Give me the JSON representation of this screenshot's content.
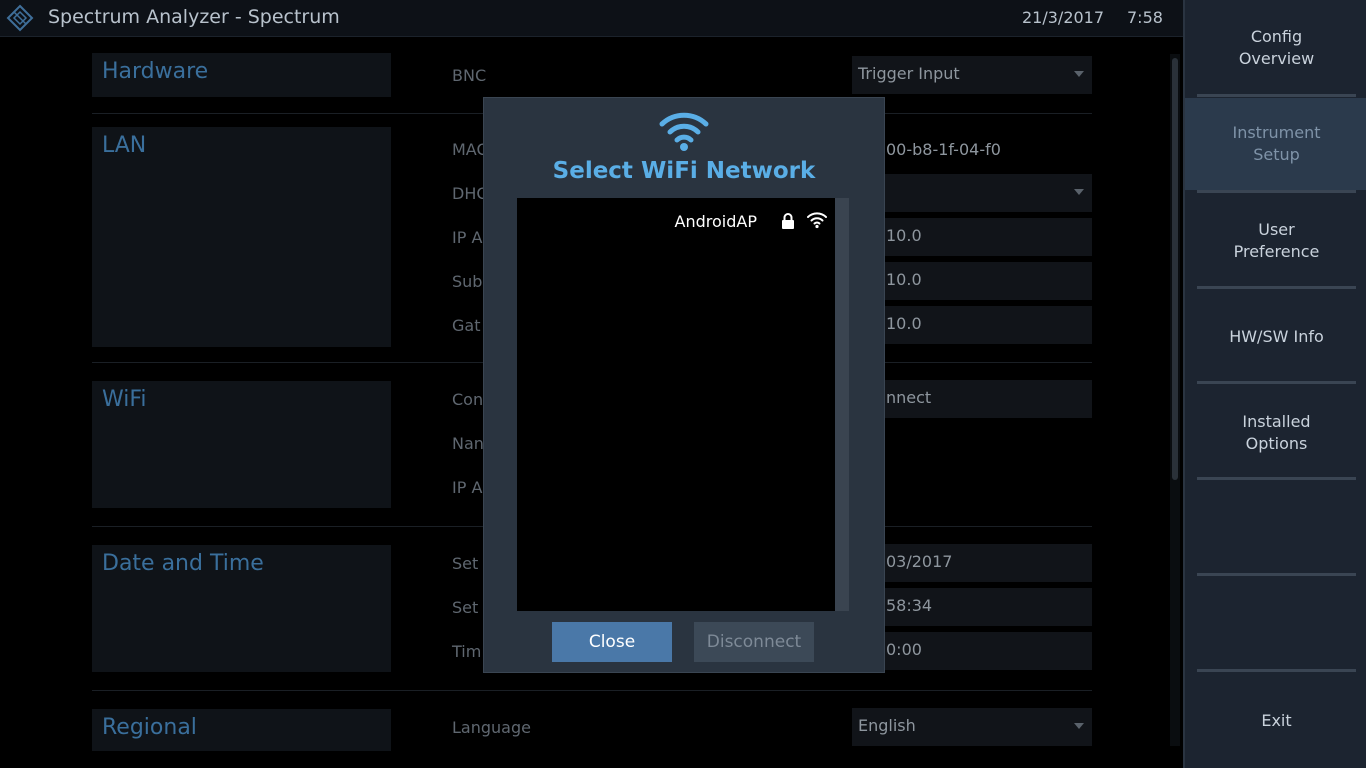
{
  "titlebar": {
    "title": "Spectrum Analyzer - Spectrum",
    "date": "21/3/2017",
    "time": "7:58"
  },
  "softkeys": [
    {
      "label": "Config\nOverview",
      "active": false
    },
    {
      "label": "Instrument\nSetup",
      "active": true
    },
    {
      "label": "User\nPreference",
      "active": false
    },
    {
      "label": "HW/SW Info",
      "active": false
    },
    {
      "label": "Installed\nOptions",
      "active": false
    },
    {
      "label": "",
      "active": false
    },
    {
      "label": "",
      "active": false
    },
    {
      "label": "Exit",
      "active": false
    }
  ],
  "sections": {
    "hardware": {
      "title": "Hardware",
      "bnc_label": "BNC",
      "bnc_value": "Trigger Input"
    },
    "lan": {
      "title": "LAN",
      "mac_label": "MAC",
      "mac_value": "00-b8-1f-04-f0",
      "dhcp_label": "DHC",
      "ip_label": "IP A",
      "ip_value": "10.0",
      "subnet_label": "Sub",
      "subnet_value": "10.0",
      "gateway_label": "Gat",
      "gateway_value": "10.0"
    },
    "wifi": {
      "title": "WiFi",
      "connect_label": "Con",
      "connect_value": "nnect",
      "name_label": "Nan",
      "ip_label": "IP A"
    },
    "datetime": {
      "title": "Date and Time",
      "date_label": "Set",
      "date_value": "03/2017",
      "time_label": "Set",
      "time_value": "58:34",
      "tz_label": "Tim",
      "tz_value": "0:00"
    },
    "regional": {
      "title": "Regional",
      "language_label": "Language",
      "language_value": "English"
    }
  },
  "dialog": {
    "title": "Select WiFi Network",
    "networks": [
      {
        "ssid": "AndroidAP",
        "secured": true
      }
    ],
    "close_label": "Close",
    "disconnect_label": "Disconnect"
  },
  "colors": {
    "accent": "#5aaee6",
    "primary_button": "#4a78a8",
    "disabled_button": "#3c4957"
  }
}
